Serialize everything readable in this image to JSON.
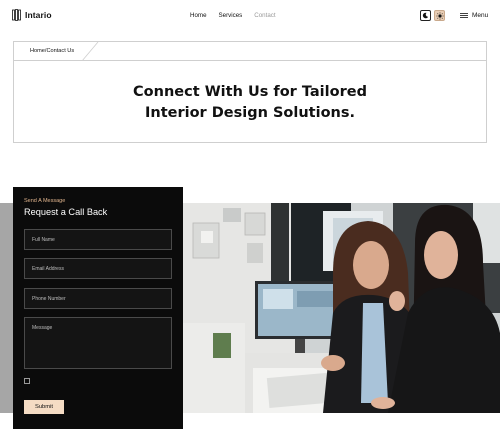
{
  "header": {
    "logo_text": "Intario",
    "nav": [
      {
        "label": "Home",
        "active": false
      },
      {
        "label": "Services",
        "active": false
      },
      {
        "label": "Contact",
        "active": true
      }
    ],
    "theme_dark_icon": "moon-icon",
    "theme_light_icon": "sun-icon",
    "menu_label": "Menu",
    "menu_icon": "hamburger-icon"
  },
  "hero": {
    "breadcrumb": "Home/Contact Us",
    "title_line1": "Connect With Us for Tailored",
    "title_line2": "Interior Design Solutions."
  },
  "form": {
    "eyebrow": "Send A Message",
    "title": "Request a Call Back",
    "fields": [
      {
        "label": "Full Name"
      },
      {
        "label": "Email Address"
      },
      {
        "label": "Phone Number"
      },
      {
        "label": "Message"
      }
    ],
    "submit_label": "Submit"
  },
  "photo": {
    "subject": "office-team-photo"
  },
  "colors": {
    "accent": "#e0b48d",
    "button_bg": "#f5dcc4",
    "card_bg": "#0b0b0b",
    "active_nav": "#9a9a9a"
  }
}
